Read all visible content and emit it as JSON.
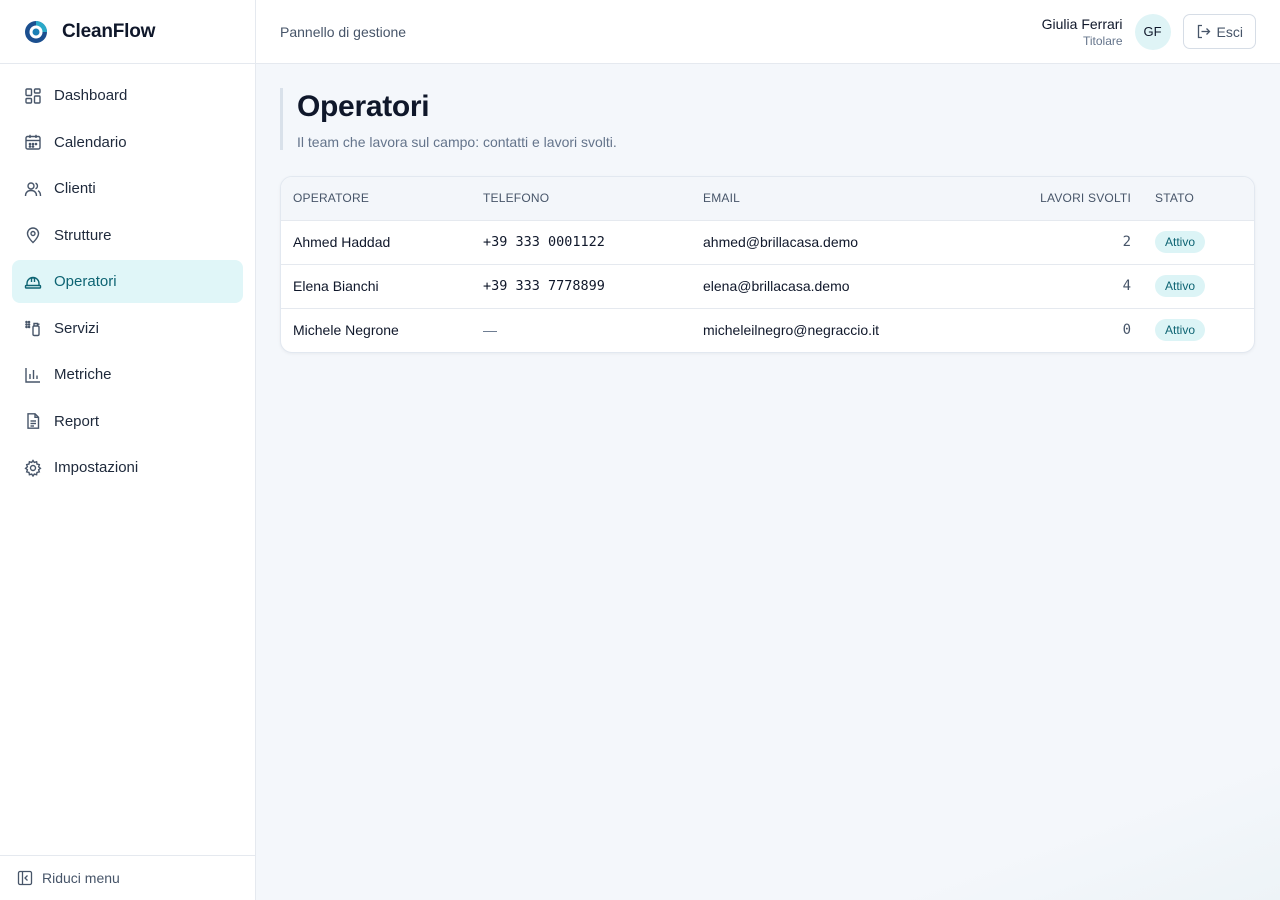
{
  "brand": {
    "name": "CleanFlow",
    "logo_icon": "cleanflow-logo-icon"
  },
  "sidebar": {
    "items": [
      {
        "label": "Dashboard",
        "icon": "dashboard-icon",
        "active": false
      },
      {
        "label": "Calendario",
        "icon": "calendar-icon",
        "active": false
      },
      {
        "label": "Clienti",
        "icon": "users-icon",
        "active": false
      },
      {
        "label": "Strutture",
        "icon": "map-pin-icon",
        "active": false
      },
      {
        "label": "Operatori",
        "icon": "hard-hat-icon",
        "active": true
      },
      {
        "label": "Servizi",
        "icon": "spray-bottle-icon",
        "active": false
      },
      {
        "label": "Metriche",
        "icon": "bar-chart-icon",
        "active": false
      },
      {
        "label": "Report",
        "icon": "document-icon",
        "active": false
      },
      {
        "label": "Impostazioni",
        "icon": "gear-icon",
        "active": false
      }
    ],
    "collapse_label": "Riduci menu"
  },
  "header": {
    "title": "Pannello di gestione",
    "user_name": "Giulia Ferrari",
    "user_role": "Titolare",
    "avatar_initials": "GF",
    "logout_label": "Esci"
  },
  "page": {
    "title": "Operatori",
    "subtitle": "Il team che lavora sul campo: contatti e lavori svolti."
  },
  "table": {
    "columns": {
      "operator": "Operatore",
      "phone": "Telefono",
      "email": "Email",
      "jobs": "Lavori svolti",
      "status": "Stato"
    },
    "rows": [
      {
        "name": "Ahmed Haddad",
        "phone": "+39 333 0001122",
        "email": "ahmed@brillacasa.demo",
        "jobs": "2",
        "status": "Attivo"
      },
      {
        "name": "Elena Bianchi",
        "phone": "+39 333 7778899",
        "email": "elena@brillacasa.demo",
        "jobs": "4",
        "status": "Attivo"
      },
      {
        "name": "Michele Negrone",
        "phone": "—",
        "email": "micheleilnegro@negraccio.it",
        "jobs": "0",
        "status": "Attivo"
      }
    ]
  },
  "colors": {
    "accent": "#0e6473",
    "accent_bg": "#e0f6f8",
    "badge_bg": "#dcf4f6"
  }
}
